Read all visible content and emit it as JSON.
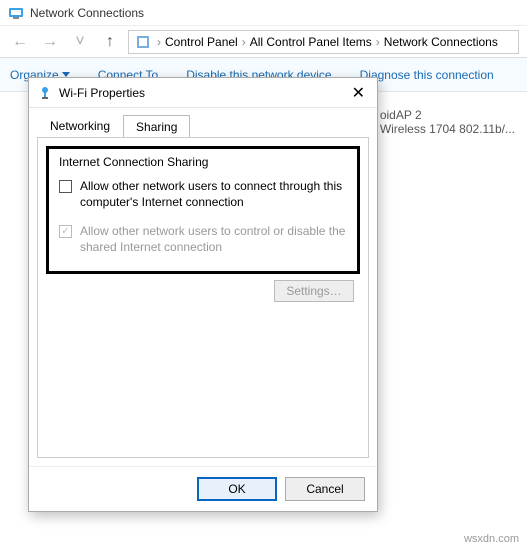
{
  "window": {
    "title": "Network Connections"
  },
  "breadcrumb": {
    "items": [
      "Control Panel",
      "All Control Panel Items",
      "Network Connections"
    ]
  },
  "commandbar": {
    "organize": "Organize",
    "connect_to": "Connect To",
    "disable": "Disable this network device",
    "diagnose": "Diagnose this connection"
  },
  "connection": {
    "name": "oidAP  2",
    "adapter": "Wireless 1704 802.11b/..."
  },
  "dialog": {
    "title": "Wi-Fi Properties",
    "tabs": {
      "networking": "Networking",
      "sharing": "Sharing"
    },
    "group_label": "Internet Connection Sharing",
    "opt1": "Allow other network users to connect through this computer's Internet connection",
    "opt2": "Allow other network users to control or disable the shared Internet connection",
    "settings": "Settings…",
    "ok": "OK",
    "cancel": "Cancel"
  },
  "watermark": "wsxdn.com"
}
